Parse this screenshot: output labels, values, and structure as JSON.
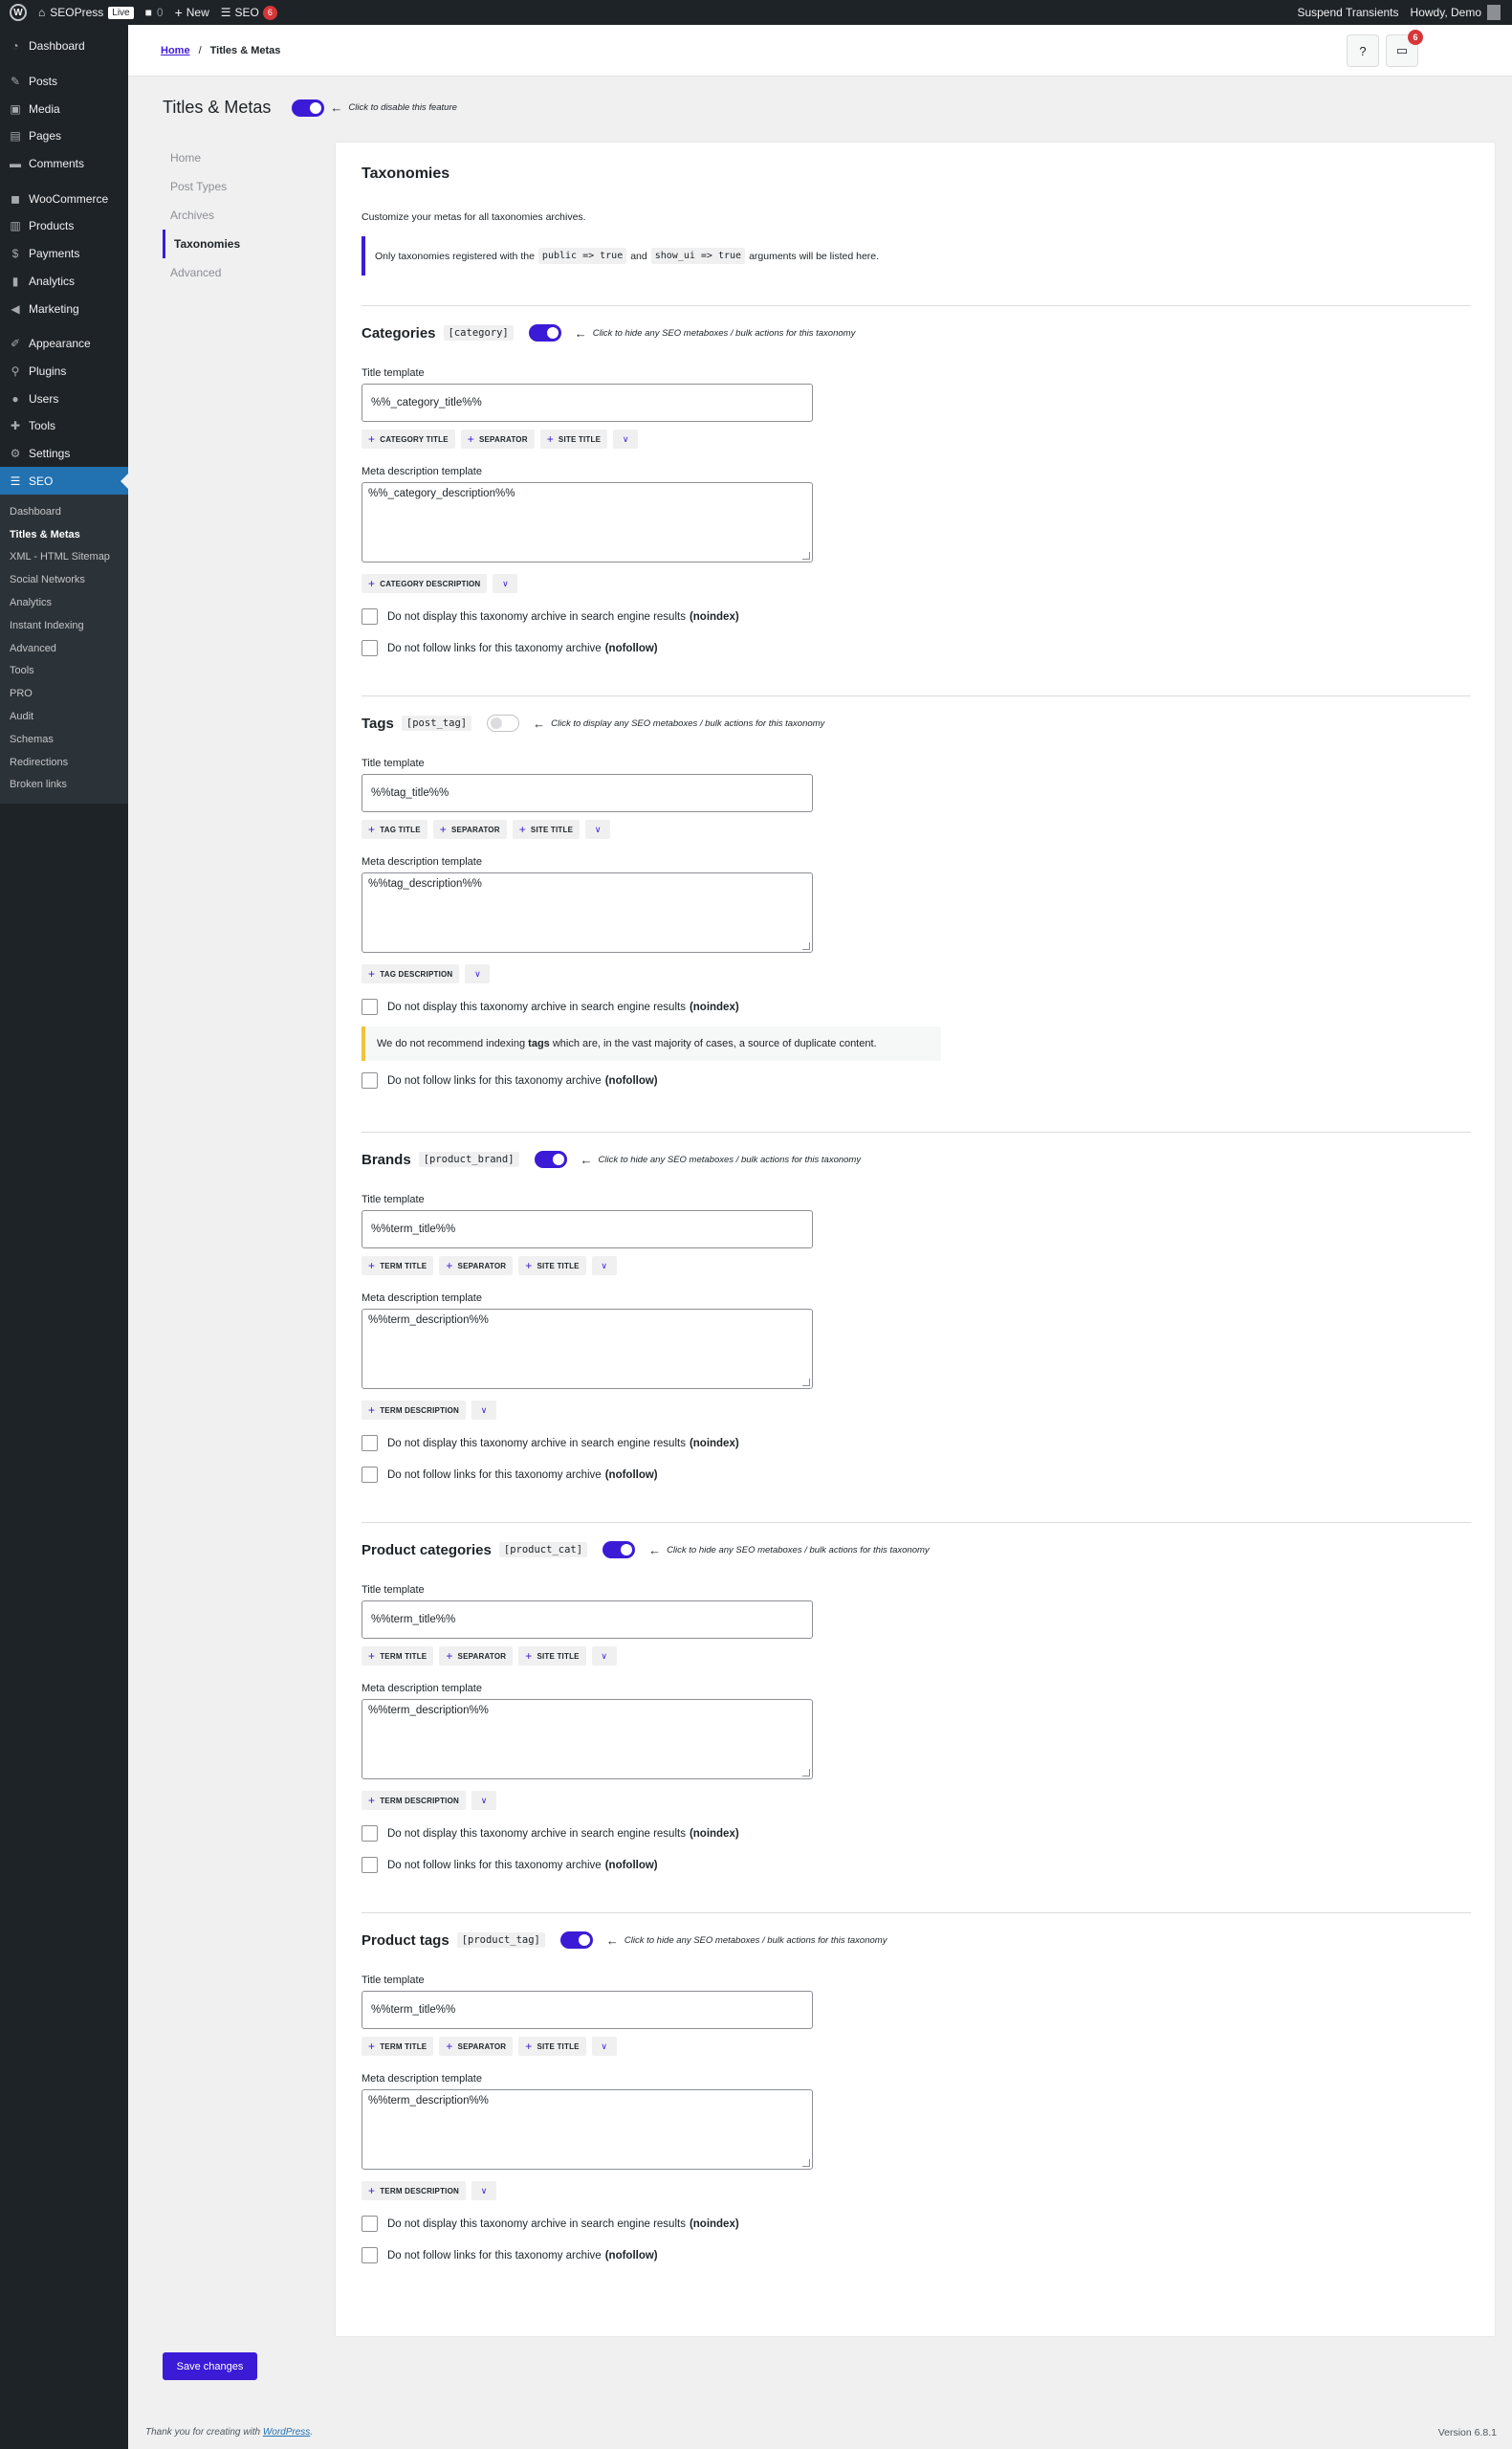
{
  "adminbar": {
    "site_name": "SEOPress",
    "live": "Live",
    "comments_count": "0",
    "new_label": "New",
    "seo_label": "SEO",
    "seo_count": "6",
    "suspend": "Suspend Transients",
    "howdy": "Howdy, Demo"
  },
  "sidebar": {
    "items": [
      {
        "label": "Dashboard",
        "icon": "dashboard-icon"
      },
      {
        "label": "Posts",
        "icon": "pin-icon"
      },
      {
        "label": "Media",
        "icon": "media-icon"
      },
      {
        "label": "Pages",
        "icon": "pages-icon"
      },
      {
        "label": "Comments",
        "icon": "comments-icon"
      },
      {
        "label": "WooCommerce",
        "icon": "woo-icon"
      },
      {
        "label": "Products",
        "icon": "products-icon"
      },
      {
        "label": "Payments",
        "icon": "payments-icon"
      },
      {
        "label": "Analytics",
        "icon": "analytics-icon"
      },
      {
        "label": "Marketing",
        "icon": "megaphone-icon"
      },
      {
        "label": "Appearance",
        "icon": "brush-icon"
      },
      {
        "label": "Plugins",
        "icon": "plugin-icon"
      },
      {
        "label": "Users",
        "icon": "users-icon"
      },
      {
        "label": "Tools",
        "icon": "wrench-icon"
      },
      {
        "label": "Settings",
        "icon": "settings-icon"
      }
    ],
    "seo_label": "SEO",
    "submenu": [
      "Dashboard",
      "Titles & Metas",
      "XML - HTML Sitemap",
      "Social Networks",
      "Analytics",
      "Instant Indexing",
      "Advanced",
      "Tools",
      "PRO",
      "Audit",
      "Schemas",
      "Redirections",
      "Broken links"
    ]
  },
  "header": {
    "home": "Home",
    "separator": "/",
    "current": "Titles & Metas",
    "notif_count": "6"
  },
  "page": {
    "title": "Titles & Metas",
    "toggle_hint": "Click to disable this feature"
  },
  "nav": [
    "Home",
    "Post Types",
    "Archives",
    "Taxonomies",
    "Advanced"
  ],
  "card": {
    "title": "Taxonomies",
    "desc": "Customize your metas for all taxonomies archives.",
    "notice_pre": "Only taxonomies registered with the",
    "notice_code1": "public => true",
    "notice_and": "and",
    "notice_code2": "show_ui => true",
    "notice_post": "arguments will be listed here."
  },
  "labels": {
    "title_template": "Title template",
    "meta_template": "Meta description template",
    "noindex_text": "Do not display this taxonomy archive in search engine results",
    "noindex_bold": "(noindex)",
    "nofollow_text": "Do not follow links for this taxonomy archive",
    "nofollow_bold": "(nofollow)",
    "hint_on": "Click to hide any SEO metaboxes / bulk actions for this taxonomy",
    "hint_off": "Click to display any SEO metaboxes / bulk actions for this taxonomy",
    "separator_tag": "SEPARATOR",
    "site_title_tag": "SITE TITLE"
  },
  "taxonomies": [
    {
      "name": "Categories",
      "slug": "[category]",
      "title_value": "%%_category_title%%",
      "title_tag": "CATEGORY TITLE",
      "meta_value": "%%_category_description%%",
      "meta_tag": "CATEGORY DESCRIPTION"
    },
    {
      "name": "Tags",
      "slug": "[post_tag]",
      "title_value": "%%tag_title%%",
      "title_tag": "TAG TITLE",
      "meta_value": "%%tag_description%%",
      "meta_tag": "TAG DESCRIPTION",
      "warn_pre": "We do not recommend indexing",
      "warn_bold": "tags",
      "warn_post": "which are, in the vast majority of cases, a source of duplicate content."
    },
    {
      "name": "Brands",
      "slug": "[product_brand]",
      "title_value": "%%term_title%%",
      "title_tag": "TERM TITLE",
      "meta_value": "%%term_description%%",
      "meta_tag": "TERM DESCRIPTION"
    },
    {
      "name": "Product categories",
      "slug": "[product_cat]",
      "title_value": "%%term_title%%",
      "title_tag": "TERM TITLE",
      "meta_value": "%%term_description%%",
      "meta_tag": "TERM DESCRIPTION"
    },
    {
      "name": "Product tags",
      "slug": "[product_tag]",
      "title_value": "%%term_title%%",
      "title_tag": "TERM TITLE",
      "meta_value": "%%term_description%%",
      "meta_tag": "TERM DESCRIPTION"
    }
  ],
  "save_label": "Save changes",
  "footer": {
    "thanks": "Thank you for creating with",
    "wp_link": "WordPress",
    "period": ".",
    "version": "Version 6.8.1"
  },
  "colors": {
    "accent": "#3c1bd6",
    "admin_dark": "#1d2327",
    "wp_blue": "#2271b1",
    "badge_red": "#d63638",
    "warn_yellow": "#f0c33c"
  }
}
